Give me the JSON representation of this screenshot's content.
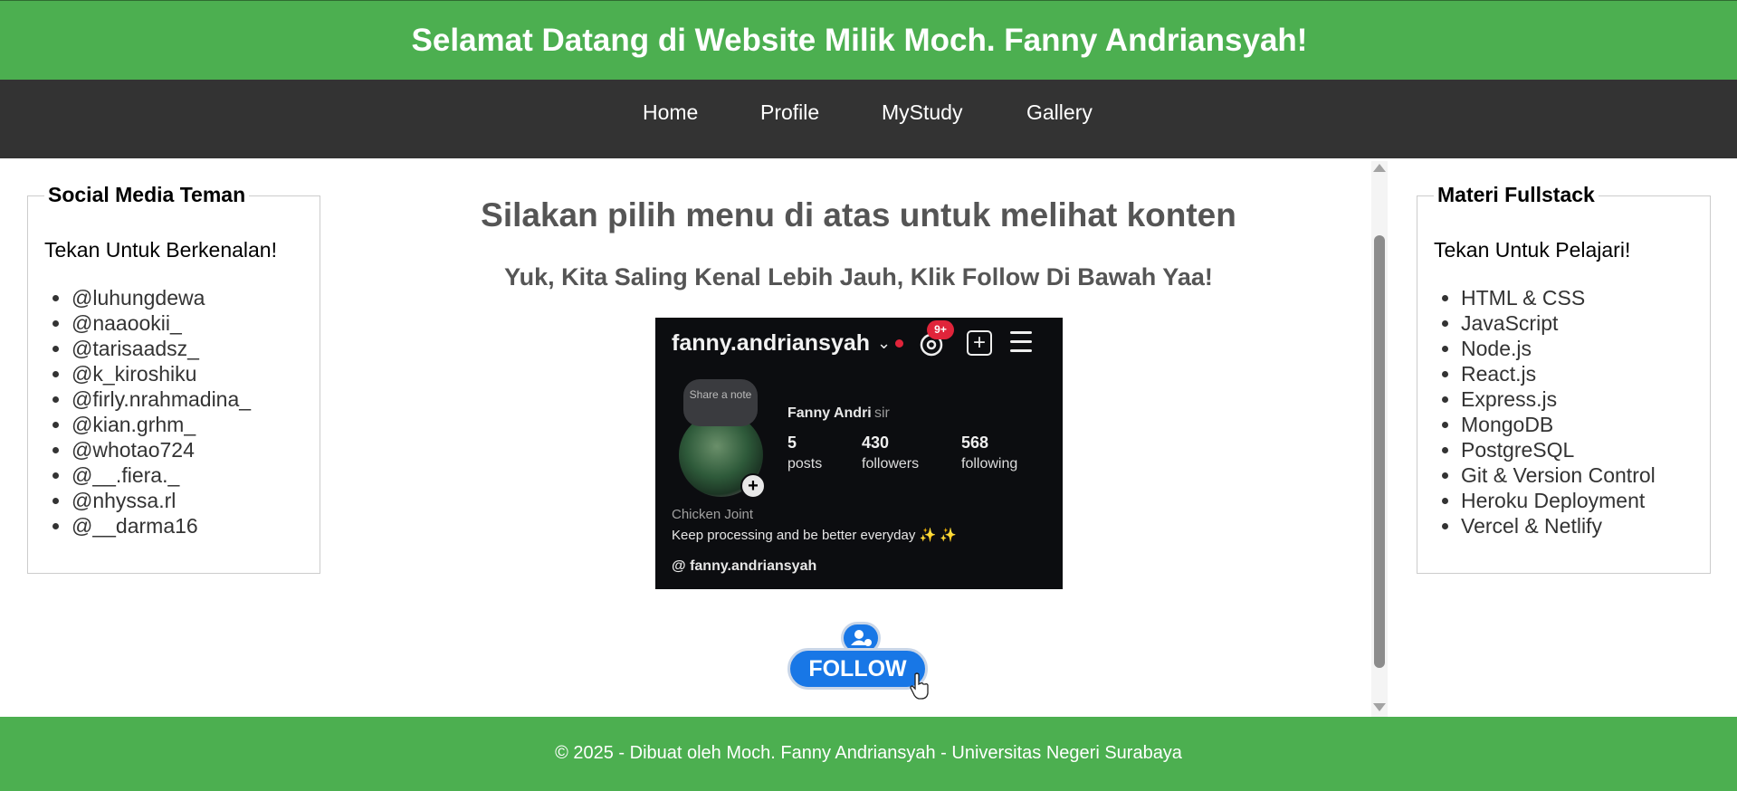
{
  "header": {
    "title": "Selamat Datang di Website Milik Moch. Fanny Andriansyah!"
  },
  "nav": {
    "items": [
      {
        "label": "Home"
      },
      {
        "label": "Profile"
      },
      {
        "label": "MyStudy"
      },
      {
        "label": "Gallery"
      }
    ]
  },
  "left_box": {
    "legend": "Social Media Teman",
    "intro": "Tekan Untuk Berkenalan!",
    "items": [
      "@luhungdewa",
      "@naaookii_",
      "@tarisaadsz_",
      "@k_kiroshiku",
      "@firly.nrahmadina_",
      "@kian.grhm_",
      "@whotao724",
      "@__.fiera._",
      "@nhyssa.rl",
      "@__darma16"
    ]
  },
  "right_box": {
    "legend": "Materi Fullstack",
    "intro": "Tekan Untuk Pelajari!",
    "items": [
      "HTML & CSS",
      "JavaScript",
      "Node.js",
      "React.js",
      "Express.js",
      "MongoDB",
      "PostgreSQL",
      "Git & Version Control",
      "Heroku Deployment",
      "Vercel & Netlify"
    ]
  },
  "main": {
    "title": "Silakan pilih menu di atas untuk melihat konten",
    "subtitle": "Yuk, Kita Saling Kenal Lebih Jauh, Klik Follow Di Bawah Yaa!",
    "follow_label": "FOLLOW"
  },
  "profile_card": {
    "username": "fanny.andriansyah",
    "notification_badge": "9+",
    "note_text": "Share a note",
    "full_name": "Fanny Andri",
    "pronoun": "sir",
    "stats": [
      {
        "number": "5",
        "label": "posts"
      },
      {
        "number": "430",
        "label": "followers"
      },
      {
        "number": "568",
        "label": "following"
      }
    ],
    "category": "Chicken Joint",
    "bio": "Keep processing and be better everyday",
    "bio_sparkles": "✨ ✨",
    "threads_handle": "fanny.andriansyah"
  },
  "footer": {
    "text": "© 2025 - Dibuat oleh Moch. Fanny Andriansyah - Universitas Negeri Surabaya"
  },
  "colors": {
    "header_bg": "#4caf50",
    "nav_bg": "#333333",
    "follow_button": "#1877e6",
    "badge_red": "#e0243a"
  },
  "icons": {
    "threads": "threads-icon",
    "add_post": "plus-square-icon",
    "menu": "hamburger-menu-icon",
    "follow": "add-user-icon",
    "cursor": "hand-pointer-icon"
  }
}
